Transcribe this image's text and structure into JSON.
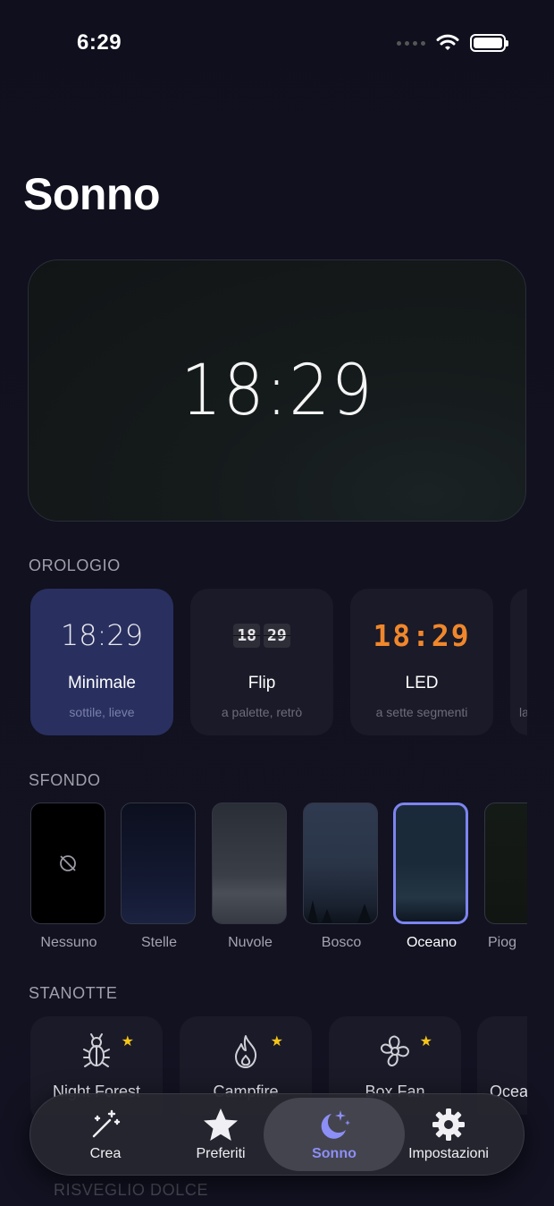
{
  "status": {
    "time": "6:29"
  },
  "title": "Sonno",
  "hero": {
    "clock": "18:29"
  },
  "sections": {
    "clock": "OROLOGIO",
    "background": "SFONDO",
    "tonight": "STANOTTE",
    "wake": "RISVEGLIO DOLCE"
  },
  "clock_styles": [
    {
      "preview": "18:29",
      "name": "Minimale",
      "sub": "sottile, lieve",
      "selected": true
    },
    {
      "preview_h": "18",
      "preview_m": "29",
      "name": "Flip",
      "sub": "a palette, retrò",
      "selected": false
    },
    {
      "preview": "18:29",
      "name": "LED",
      "sub": "a sette segmenti",
      "selected": false
    },
    {
      "sub": "la"
    }
  ],
  "backgrounds": [
    {
      "label": "Nessuno",
      "icon": "no-background-icon"
    },
    {
      "label": "Stelle"
    },
    {
      "label": "Nuvole"
    },
    {
      "label": "Bosco"
    },
    {
      "label": "Oceano",
      "selected": true
    },
    {
      "label": "Piog"
    }
  ],
  "tonight": [
    {
      "name": "Night Forest",
      "icon": "bug-icon",
      "favorite": true
    },
    {
      "name": "Campfire",
      "icon": "flame-icon",
      "favorite": true
    },
    {
      "name": "Box Fan",
      "icon": "fan-icon",
      "favorite": true
    },
    {
      "name": "Ocea"
    }
  ],
  "tabs": [
    {
      "label": "Crea",
      "icon": "magic-wand-icon"
    },
    {
      "label": "Preferiti",
      "icon": "star-icon"
    },
    {
      "label": "Sonno",
      "icon": "moon-stars-icon",
      "active": true
    },
    {
      "label": "Impostazioni",
      "icon": "gear-icon"
    }
  ],
  "colors": {
    "accent": "#8c8ff5",
    "led": "#f0872c",
    "favorite": "#f5c518",
    "selected_card": "#29305f"
  }
}
